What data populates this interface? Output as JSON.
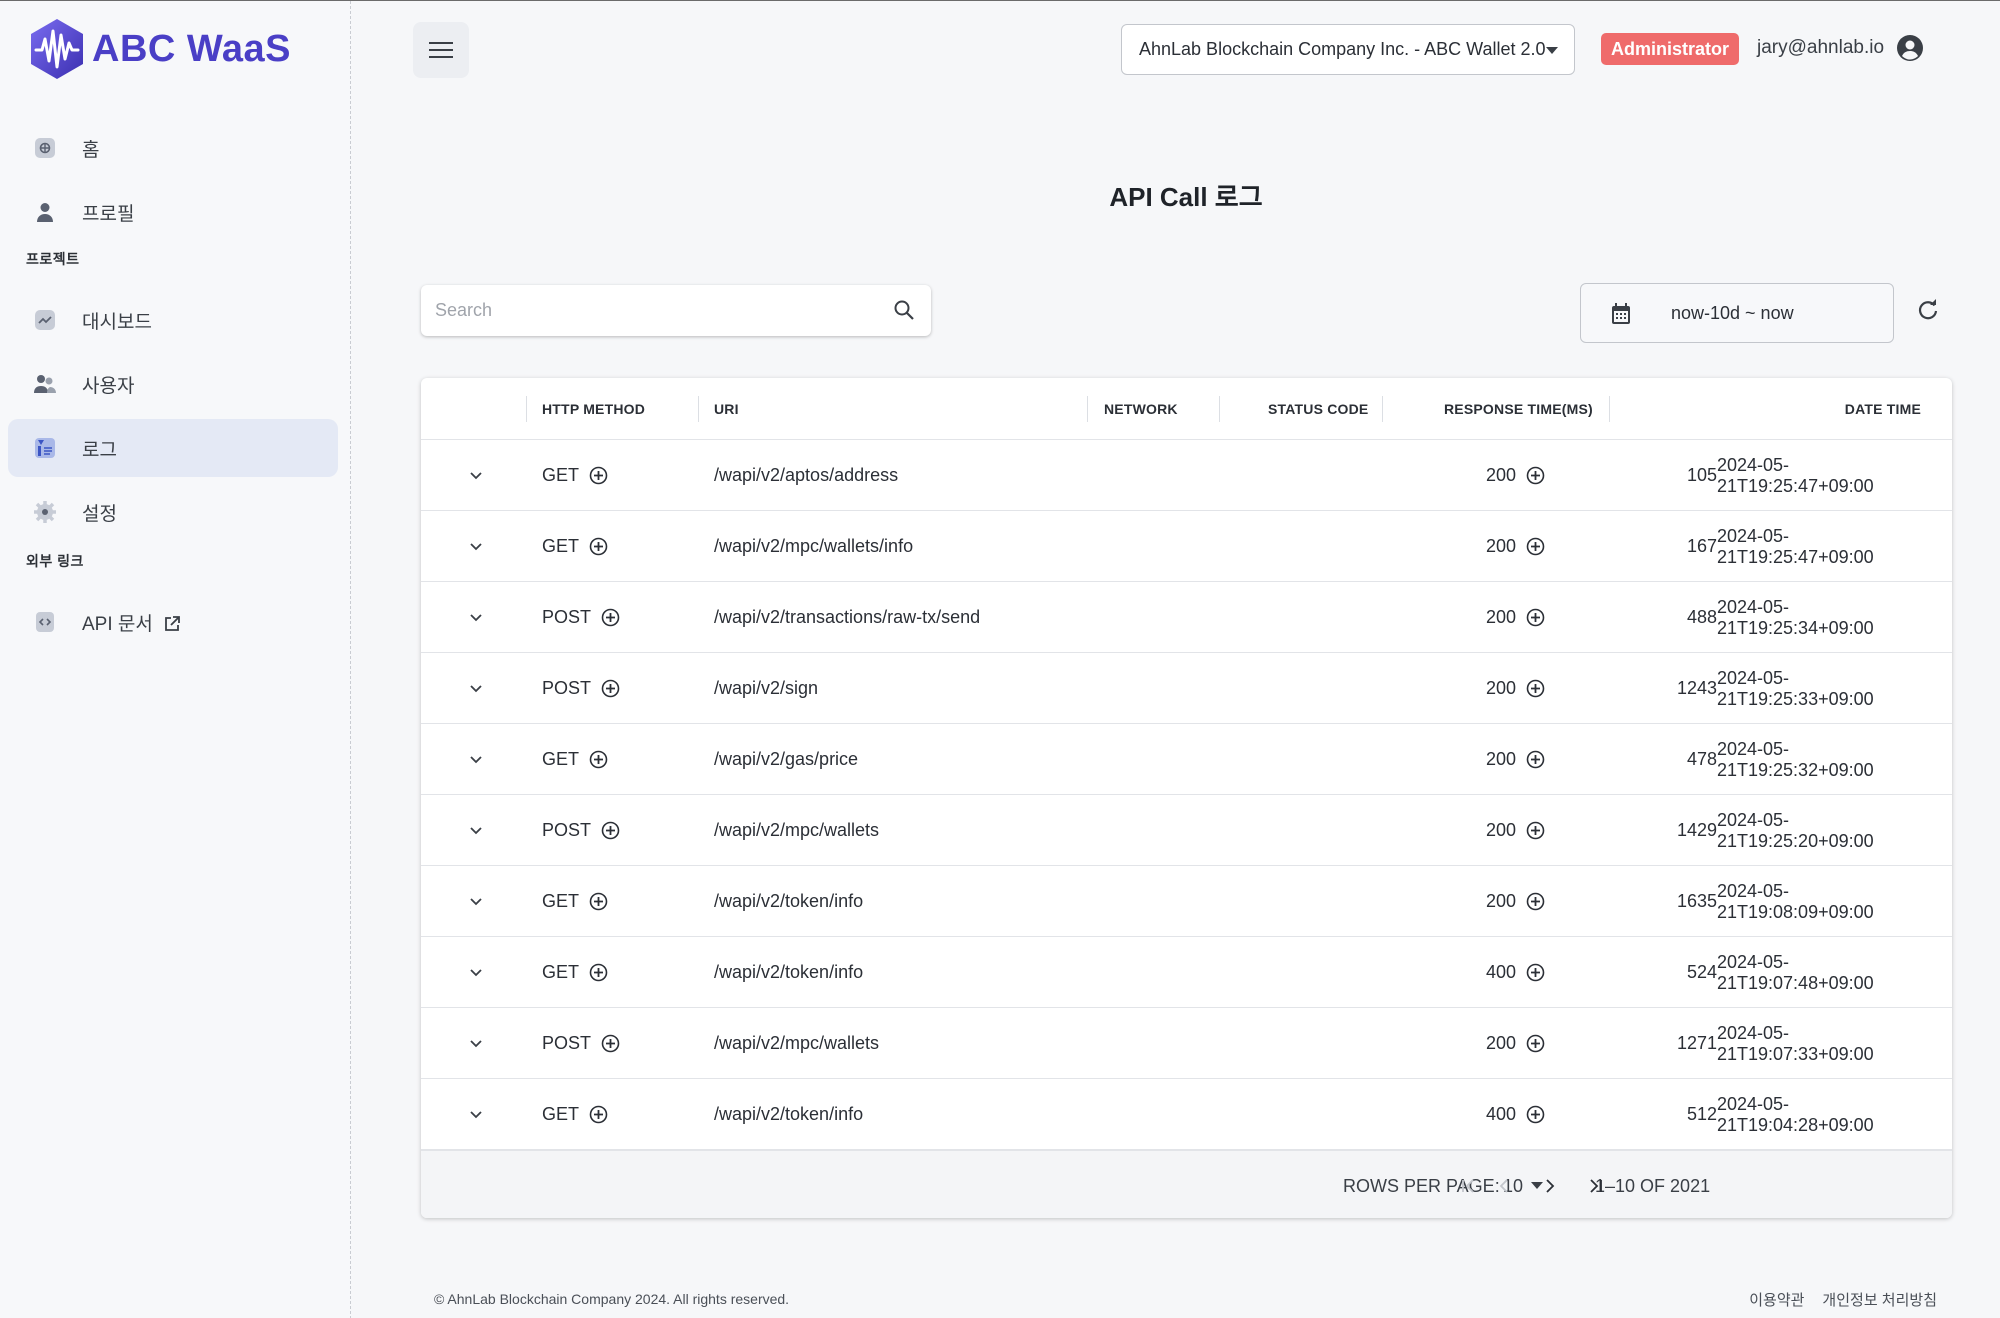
{
  "brand": {
    "name": "ABC WaaS",
    "color": "#4a3fc6"
  },
  "sidebar": {
    "items_top": [
      {
        "label": "홈",
        "icon": "home-icon"
      },
      {
        "label": "프로필",
        "icon": "person-icon"
      }
    ],
    "section_project": "프로젝트",
    "items_project": [
      {
        "label": "대시보드",
        "icon": "chart-icon"
      },
      {
        "label": "사용자",
        "icon": "users-icon"
      },
      {
        "label": "로그",
        "icon": "log-icon",
        "active": true
      },
      {
        "label": "설정",
        "icon": "gear-icon"
      }
    ],
    "section_external": "외부 링크",
    "items_external": [
      {
        "label": "API 문서",
        "icon": "code-doc-icon"
      }
    ]
  },
  "header": {
    "org_select": "AhnLab Blockchain Company Inc. - ABC Wallet 2.0",
    "role_badge": "Administrator",
    "role_color": "#ef6b6b",
    "user_email": "jary@ahnlab.io"
  },
  "page": {
    "title": "API Call 로그",
    "search_placeholder": "Search",
    "date_range": "now-10d ~ now"
  },
  "table": {
    "columns": {
      "method": "HTTP METHOD",
      "uri": "URI",
      "network": "NETWORK",
      "status": "STATUS CODE",
      "response": "RESPONSE TIME(MS)",
      "date": "DATE TIME"
    },
    "rows": [
      {
        "method": "GET",
        "uri": "/wapi/v2/aptos/address",
        "status": "200",
        "response": "105",
        "date": "2024-05-21T19:25:47+09:00"
      },
      {
        "method": "GET",
        "uri": "/wapi/v2/mpc/wallets/info",
        "status": "200",
        "response": "167",
        "date": "2024-05-21T19:25:47+09:00"
      },
      {
        "method": "POST",
        "uri": "/wapi/v2/transactions/raw-tx/send",
        "status": "200",
        "response": "488",
        "date": "2024-05-21T19:25:34+09:00"
      },
      {
        "method": "POST",
        "uri": "/wapi/v2/sign",
        "status": "200",
        "response": "1243",
        "date": "2024-05-21T19:25:33+09:00"
      },
      {
        "method": "GET",
        "uri": "/wapi/v2/gas/price",
        "status": "200",
        "response": "478",
        "date": "2024-05-21T19:25:32+09:00"
      },
      {
        "method": "POST",
        "uri": "/wapi/v2/mpc/wallets",
        "status": "200",
        "response": "1429",
        "date": "2024-05-21T19:25:20+09:00"
      },
      {
        "method": "GET",
        "uri": "/wapi/v2/token/info",
        "status": "200",
        "response": "1635",
        "date": "2024-05-21T19:08:09+09:00"
      },
      {
        "method": "GET",
        "uri": "/wapi/v2/token/info",
        "status": "400",
        "response": "524",
        "date": "2024-05-21T19:07:48+09:00"
      },
      {
        "method": "POST",
        "uri": "/wapi/v2/mpc/wallets",
        "status": "200",
        "response": "1271",
        "date": "2024-05-21T19:07:33+09:00"
      },
      {
        "method": "GET",
        "uri": "/wapi/v2/token/info",
        "status": "400",
        "response": "512",
        "date": "2024-05-21T19:04:28+09:00"
      }
    ],
    "pagination": {
      "rows_per_page_label": "ROWS PER PAGE:",
      "rows_per_page": "10",
      "range": "1–10 OF 2021"
    }
  },
  "footer": {
    "copyright": "© AhnLab Blockchain Company 2024. All rights reserved.",
    "terms": "이용약관",
    "privacy": "개인정보 처리방침"
  }
}
